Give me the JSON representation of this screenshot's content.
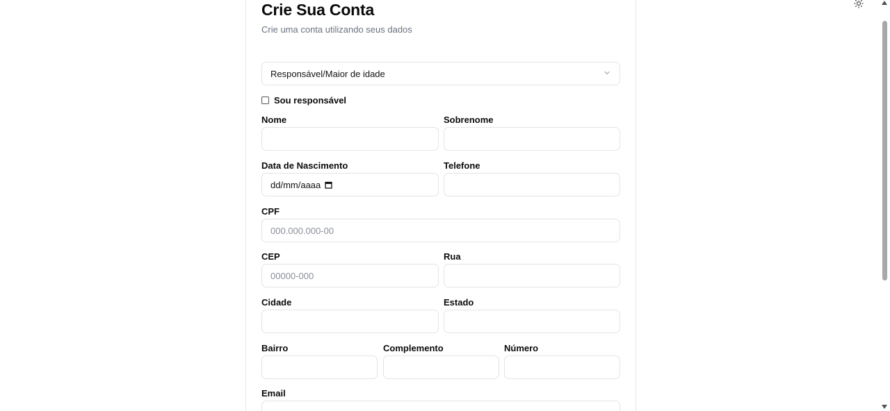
{
  "form": {
    "title": "Crie Sua Conta",
    "subtitle": "Crie uma conta utilizando seus dados",
    "account_type_select": {
      "selected": "Responsável/Maior de idade"
    },
    "responsible_checkbox": {
      "label": "Sou responsável",
      "checked": false
    },
    "fields": {
      "nome": {
        "label": "Nome",
        "value": "",
        "placeholder": ""
      },
      "sobrenome": {
        "label": "Sobrenome",
        "value": "",
        "placeholder": ""
      },
      "data_nascimento": {
        "label": "Data de Nascimento",
        "placeholder": "dd/mm/aaaa"
      },
      "telefone": {
        "label": "Telefone",
        "value": "",
        "placeholder": ""
      },
      "cpf": {
        "label": "CPF",
        "placeholder": "000.000.000-00"
      },
      "cep": {
        "label": "CEP",
        "placeholder": "00000-000"
      },
      "rua": {
        "label": "Rua",
        "value": "",
        "placeholder": ""
      },
      "cidade": {
        "label": "Cidade",
        "value": "",
        "placeholder": ""
      },
      "estado": {
        "label": "Estado",
        "value": "",
        "placeholder": ""
      },
      "bairro": {
        "label": "Bairro",
        "value": "",
        "placeholder": ""
      },
      "complemento": {
        "label": "Complemento",
        "value": "",
        "placeholder": ""
      },
      "numero": {
        "label": "Número",
        "value": "",
        "placeholder": ""
      },
      "email": {
        "label": "Email",
        "value": "",
        "placeholder": ""
      }
    }
  },
  "icons": {
    "theme_toggle": "sun-icon",
    "select_chevron": "chevron-down-icon",
    "date_picker": "calendar-icon"
  },
  "colors": {
    "border": "#e2e4e8",
    "muted_text": "#6b7280",
    "placeholder": "#8a8f98"
  }
}
